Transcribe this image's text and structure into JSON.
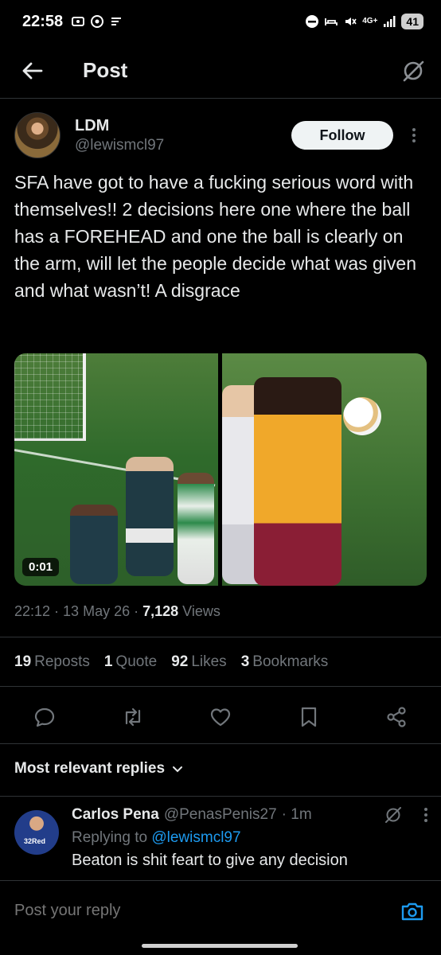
{
  "status_bar": {
    "time": "22:58",
    "network": "4G+",
    "battery": "41"
  },
  "header": {
    "title": "Post",
    "icons": {
      "back": "arrow-left-icon",
      "grok": "grok-icon"
    }
  },
  "author": {
    "name": "LDM",
    "handle": "@lewismcl97",
    "follow_label": "Follow"
  },
  "post": {
    "text": "SFA have got to have a fucking serious word with themselves!! 2 decisions here one where the ball has a FOREHEAD and one the ball is clearly on the arm, will let the people decide what was given and what wasn’t! A disgrace",
    "video_duration": "0:01",
    "time": "22:12",
    "date": "13 May 26",
    "views_count": "7,128",
    "views_label": "Views"
  },
  "stats": {
    "reposts_count": "19",
    "reposts_label": "Reposts",
    "quotes_count": "1",
    "quotes_label": "Quote",
    "likes_count": "92",
    "likes_label": "Likes",
    "bookmarks_count": "3",
    "bookmarks_label": "Bookmarks"
  },
  "actions": [
    "reply-icon",
    "repost-icon",
    "like-icon",
    "bookmark-icon",
    "share-icon"
  ],
  "replies": {
    "sort_label": "Most relevant replies",
    "items": [
      {
        "name": "Carlos Pena",
        "handle": "@PenasPenis27",
        "age": "· 1m",
        "replying_prefix": "Replying to",
        "replying_to": "@lewismcl97",
        "text": "Beaton is shit feart to give any decision",
        "avatar_text": "32Red"
      }
    ]
  },
  "composer": {
    "placeholder": "Post your reply"
  },
  "colors": {
    "background": "#000000",
    "text": "#e7e9ea",
    "muted": "#71767b",
    "accent": "#1d9bf0",
    "divider": "#2f3336"
  }
}
